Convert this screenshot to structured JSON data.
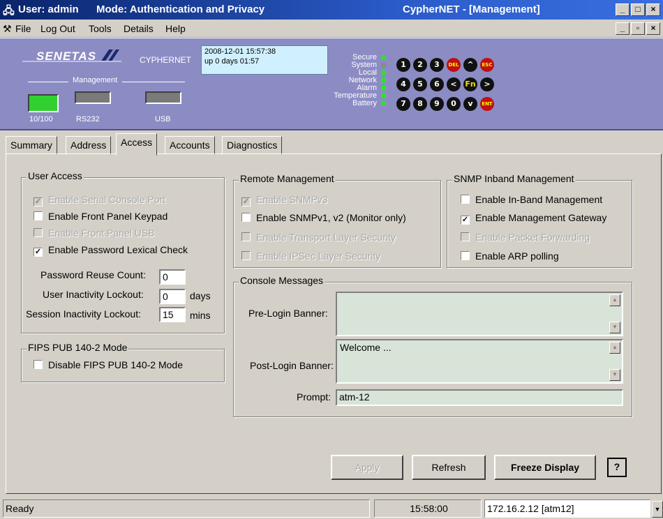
{
  "window": {
    "title_user": "User: admin",
    "title_mode": "Mode: Authentication and Privacy",
    "title_app": "CypherNET - [Management]",
    "min_label": "_",
    "max_label": "□",
    "close_label": "×",
    "mdi_min_label": "_",
    "mdi_restore_label": "▫",
    "mdi_close_label": "×"
  },
  "menu": {
    "file": "File",
    "logout": "Log Out",
    "tools": "Tools",
    "details": "Details",
    "help": "Help"
  },
  "device": {
    "brand": "SENETAS",
    "product": "CYPHERNET",
    "datetime": "2008-12-01 15:57:38",
    "uptime": "up 0 days 01:57",
    "management_label": "Management",
    "ports": [
      "10/100",
      "RS232",
      "USB"
    ],
    "port_colors": [
      "#30d030",
      "#7a7a7a",
      "#7a7a7a"
    ],
    "status_labels": [
      "Secure",
      "System",
      "Local",
      "Network",
      "Alarm",
      "Temperature",
      "Battery"
    ],
    "status_on": [
      true,
      false,
      true,
      true,
      true,
      true,
      true
    ],
    "keypad_row1": [
      "1",
      "2",
      "3",
      "DEL",
      "^",
      "ESC"
    ],
    "keypad_row2": [
      "4",
      "5",
      "6",
      "<",
      "Fn",
      ">"
    ],
    "keypad_row3": [
      "7",
      "8",
      "9",
      "0",
      "v",
      "ENT"
    ]
  },
  "tabs": [
    "Summary",
    "Address",
    "Access",
    "Accounts",
    "Diagnostics"
  ],
  "active_tab": "Access",
  "user_access": {
    "title": "User Access",
    "serial_console": {
      "label": "Enable Serial Console Port",
      "checked": true,
      "disabled": true
    },
    "front_keypad": {
      "label": "Enable Front Panel Keypad",
      "checked": false,
      "disabled": false
    },
    "front_usb": {
      "label": "Enable Front Panel USB",
      "checked": false,
      "disabled": true
    },
    "password_lexical": {
      "label": "Enable Password Lexical Check",
      "checked": true,
      "disabled": false
    },
    "reuse_label": "Password Reuse Count:",
    "reuse_value": "0",
    "inactivity_label": "User Inactivity Lockout:",
    "inactivity_value": "0",
    "inactivity_unit": "days",
    "session_label": "Session Inactivity Lockout:",
    "session_value": "15",
    "session_unit": "mins"
  },
  "fips": {
    "title": "FIPS PUB 140-2 Mode",
    "disable": {
      "label": "Disable FIPS PUB 140-2 Mode",
      "checked": false
    }
  },
  "remote": {
    "title": "Remote Management",
    "snmpv3": {
      "label": "Enable SNMPv3",
      "checked": true,
      "disabled": true
    },
    "snmpv1": {
      "label": "Enable SNMPv1, v2  (Monitor only)",
      "checked": false,
      "disabled": false
    },
    "tls": {
      "label": "Enable Transport Layer Security",
      "checked": false,
      "disabled": true
    },
    "ipsec": {
      "label": "Enable IPSec Layer Security",
      "checked": false,
      "disabled": true
    }
  },
  "snmp": {
    "title": "SNMP Inband Management",
    "inband": {
      "label": "Enable In-Band Management",
      "checked": false,
      "disabled": false
    },
    "gateway": {
      "label": "Enable Management Gateway",
      "checked": true,
      "disabled": false
    },
    "forwarding": {
      "label": "Enable Packet Forwarding",
      "checked": false,
      "disabled": true
    },
    "arp": {
      "label": "Enable ARP polling",
      "checked": false,
      "disabled": false
    }
  },
  "console": {
    "title": "Console Messages",
    "pre_label": "Pre-Login Banner:",
    "pre_value": "",
    "post_label": "Post-Login Banner:",
    "post_value": "Welcome ...",
    "prompt_label": "Prompt:",
    "prompt_value": "atm-12"
  },
  "buttons": {
    "apply": "Apply",
    "refresh": "Refresh",
    "freeze": "Freeze Display",
    "help": "?"
  },
  "statusbar": {
    "status": "Ready",
    "time": "15:58:00",
    "connection": "172.16.2.12 [atm12]"
  }
}
